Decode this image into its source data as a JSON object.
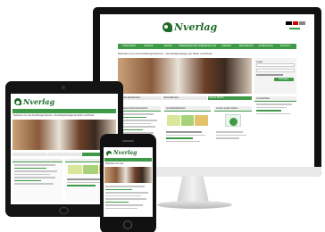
{
  "brand": {
    "logo_text": "Nverlag",
    "green": "#3e9a46",
    "dark_green": "#1f6b2a"
  },
  "desktop": {
    "nav": [
      "STARTSEITE",
      "PFERDE",
      "REITEN",
      "PFERDEGESUNDHEIT",
      "PFERDEHALTUNG",
      "FREIZEIT",
      "ERNAHRUNG",
      "AUSBILDUNG",
      "KONTAKT"
    ],
    "headline": "Reitzeiten von Lisa Fuchsberger/prismus ~ Die Erfolgsstrategie der Reiter und Pferde",
    "tabs": [
      "Neueste Reiterbücher",
      "Reiten/Bereiter",
      "Seltene Bücher"
    ],
    "box_titles": [
      "Neueste Reitzeitrtenbücher",
      "Grünfarbtabbücher",
      "Unsere Lieder Reiten"
    ],
    "login_label": "Login",
    "login_button": "Einloggen",
    "sidebar_title": "Grünfarbtabs"
  },
  "tablet": {
    "headline": "Reitzeiten von Lisa Fuchsberger/prismus ~ Die Erfolgsstrategie der Reiter und Pferde"
  },
  "phone": {
    "headline": "Reitzeiten von Lisa"
  }
}
